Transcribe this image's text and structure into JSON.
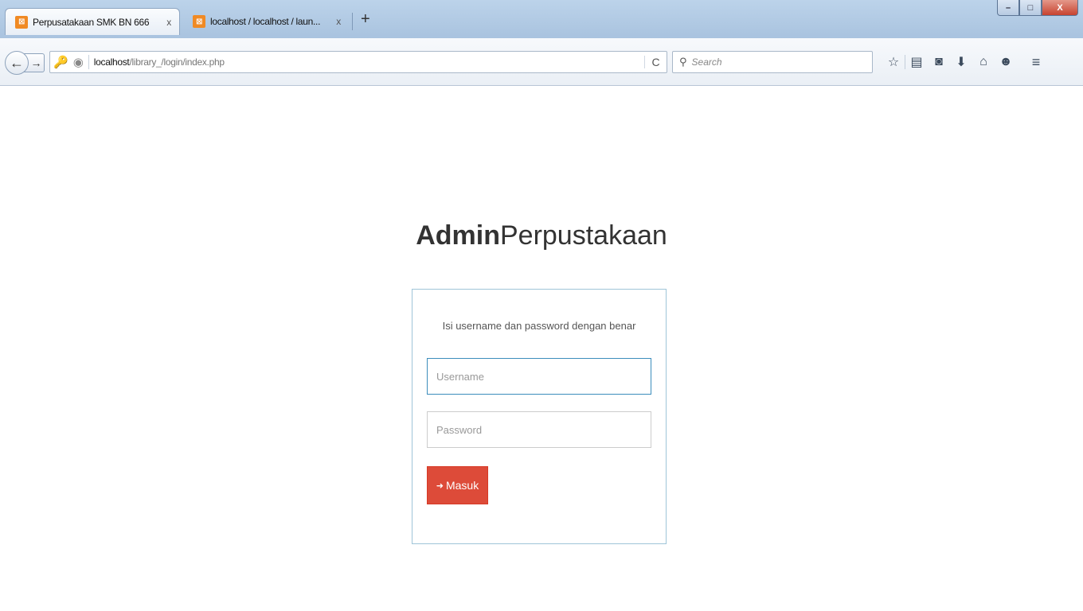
{
  "browser": {
    "tabs": [
      {
        "label": "Perpusatakaan SMK BN 666",
        "close": "x",
        "active": true
      },
      {
        "label": "localhost / localhost / laun...",
        "close": "x",
        "active": false
      }
    ],
    "new_tab": "+",
    "window_controls": {
      "minimize": "–",
      "maximize": "□",
      "close": "X"
    },
    "nav": {
      "back": "←",
      "forward": "→"
    },
    "url": {
      "host": "localhost",
      "path": "/library_/login/index.php"
    },
    "reload": "C",
    "search": {
      "placeholder": "Search"
    },
    "toolbar_icons": [
      "star-icon",
      "reading-list-icon",
      "pocket-icon",
      "download-icon",
      "home-icon",
      "chat-icon",
      "menu-icon"
    ]
  },
  "page": {
    "brand_bold": "Admin",
    "brand_rest": "Perpustakaan",
    "login": {
      "message": "Isi username dan password dengan benar",
      "username_placeholder": "Username",
      "password_placeholder": "Password",
      "submit_label": "Masuk"
    }
  },
  "colors": {
    "button": "#dd4b39",
    "box_border": "#9fc5d8",
    "focus": "#3c8dbc"
  }
}
